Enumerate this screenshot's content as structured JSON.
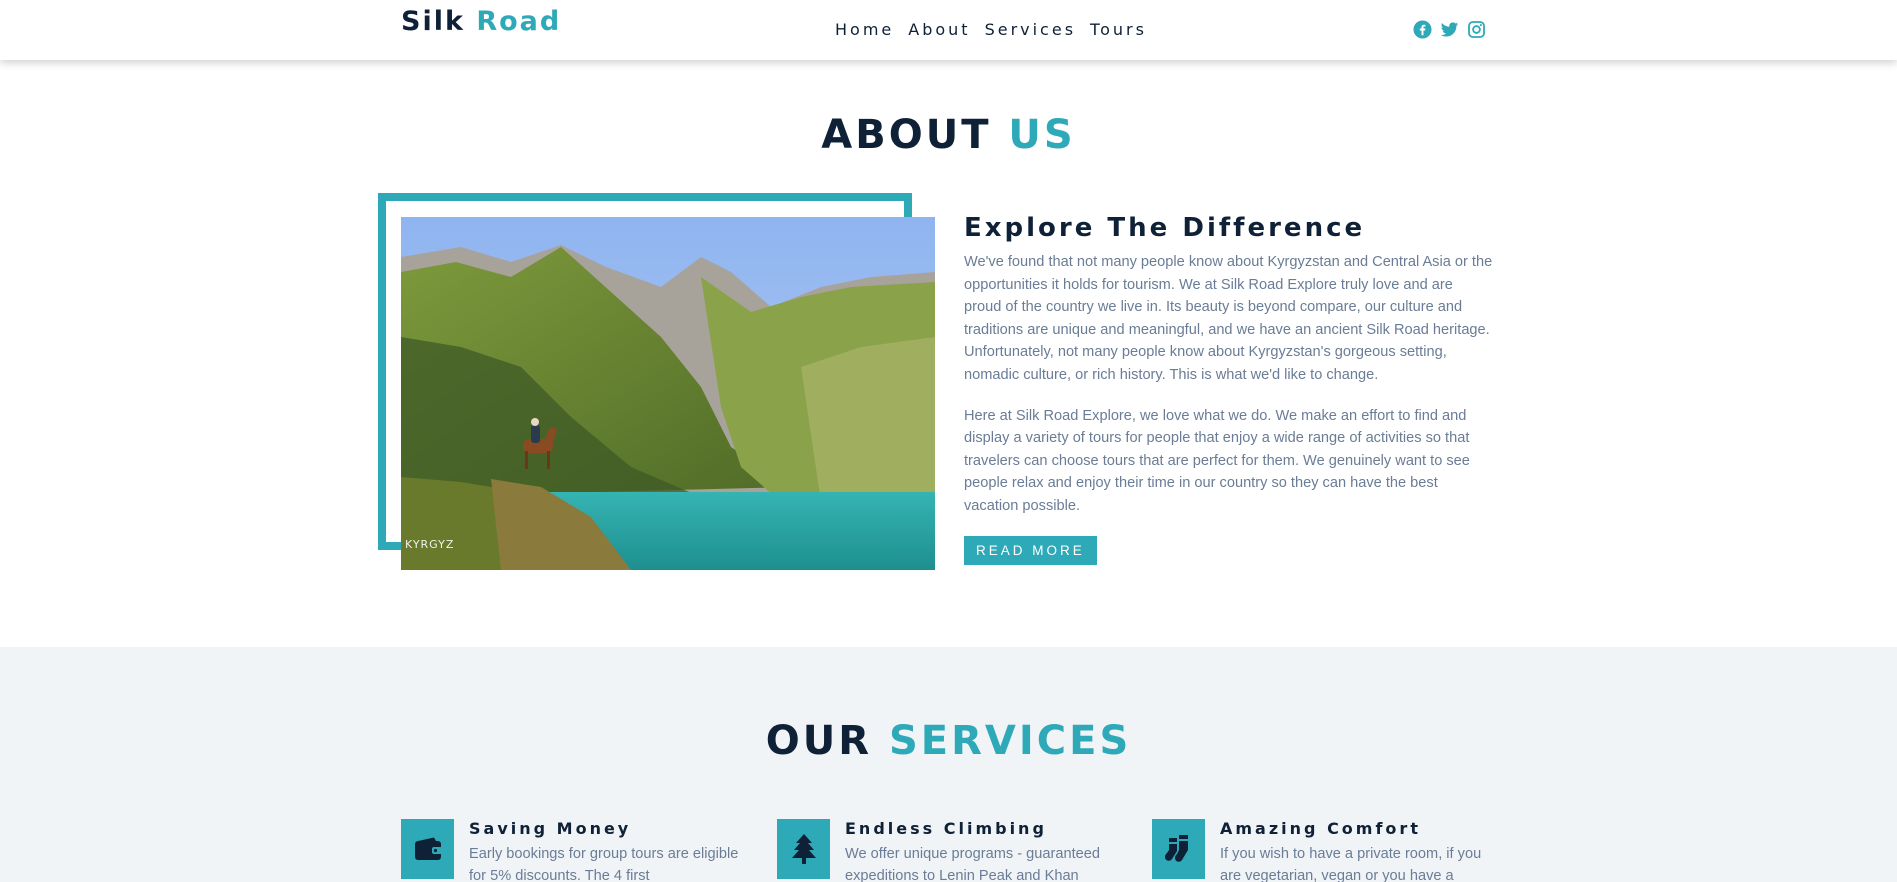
{
  "nav": {
    "logo_main": "Silk",
    "logo_accent": "Road",
    "links": [
      "Home",
      "About",
      "Services",
      "Tours"
    ],
    "social_icons": [
      "facebook-icon",
      "twitter-icon",
      "instagram-icon"
    ]
  },
  "about": {
    "title_main": "ABOUT",
    "title_accent": "US",
    "heading": "Explore The Difference",
    "paragraphs": [
      "We've found that not many people know about Kyrgyzstan and Central Asia or the opportunities it holds for tourism. We at Silk Road Explore truly love and are proud of the country we live in. Its beauty is beyond compare, our culture and traditions are unique and meaningful, and we have an ancient Silk Road heritage. Unfortunately, not many people know about Kyrgyzstan's gorgeous setting, nomadic culture, or rich history. This is what we'd like to change.",
      "Here at Silk Road Explore, we love what we do. We make an effort to find and display a variety of tours for people that enjoy a wide range of activities so that travelers can choose tours that are perfect for them. We genuinely want to see people relax and enjoy their time in our country so they can have the best vacation possible."
    ],
    "button_label": "READ MORE",
    "photo_watermark": "KYRGYZ"
  },
  "services": {
    "title_main": "OUR",
    "title_accent": "SERVICES",
    "items": [
      {
        "title": "Saving Money",
        "text": "Early bookings for group tours are eligible for 5% discounts. The 4 first",
        "icon": "wallet-icon"
      },
      {
        "title": "Endless Climbing",
        "text": "We offer unique programs - guaranteed expeditions to Lenin Peak and Khan",
        "icon": "tree-icon"
      },
      {
        "title": "Amazing Comfort",
        "text": "If you wish to have a private room, if you are vegetarian, vegan or you have a",
        "icon": "socks-icon"
      }
    ]
  },
  "colors": {
    "accent": "#2ea9b8",
    "dark": "#0f2137",
    "body_text": "#6a7c96",
    "section_bg": "#f1f4f7"
  }
}
